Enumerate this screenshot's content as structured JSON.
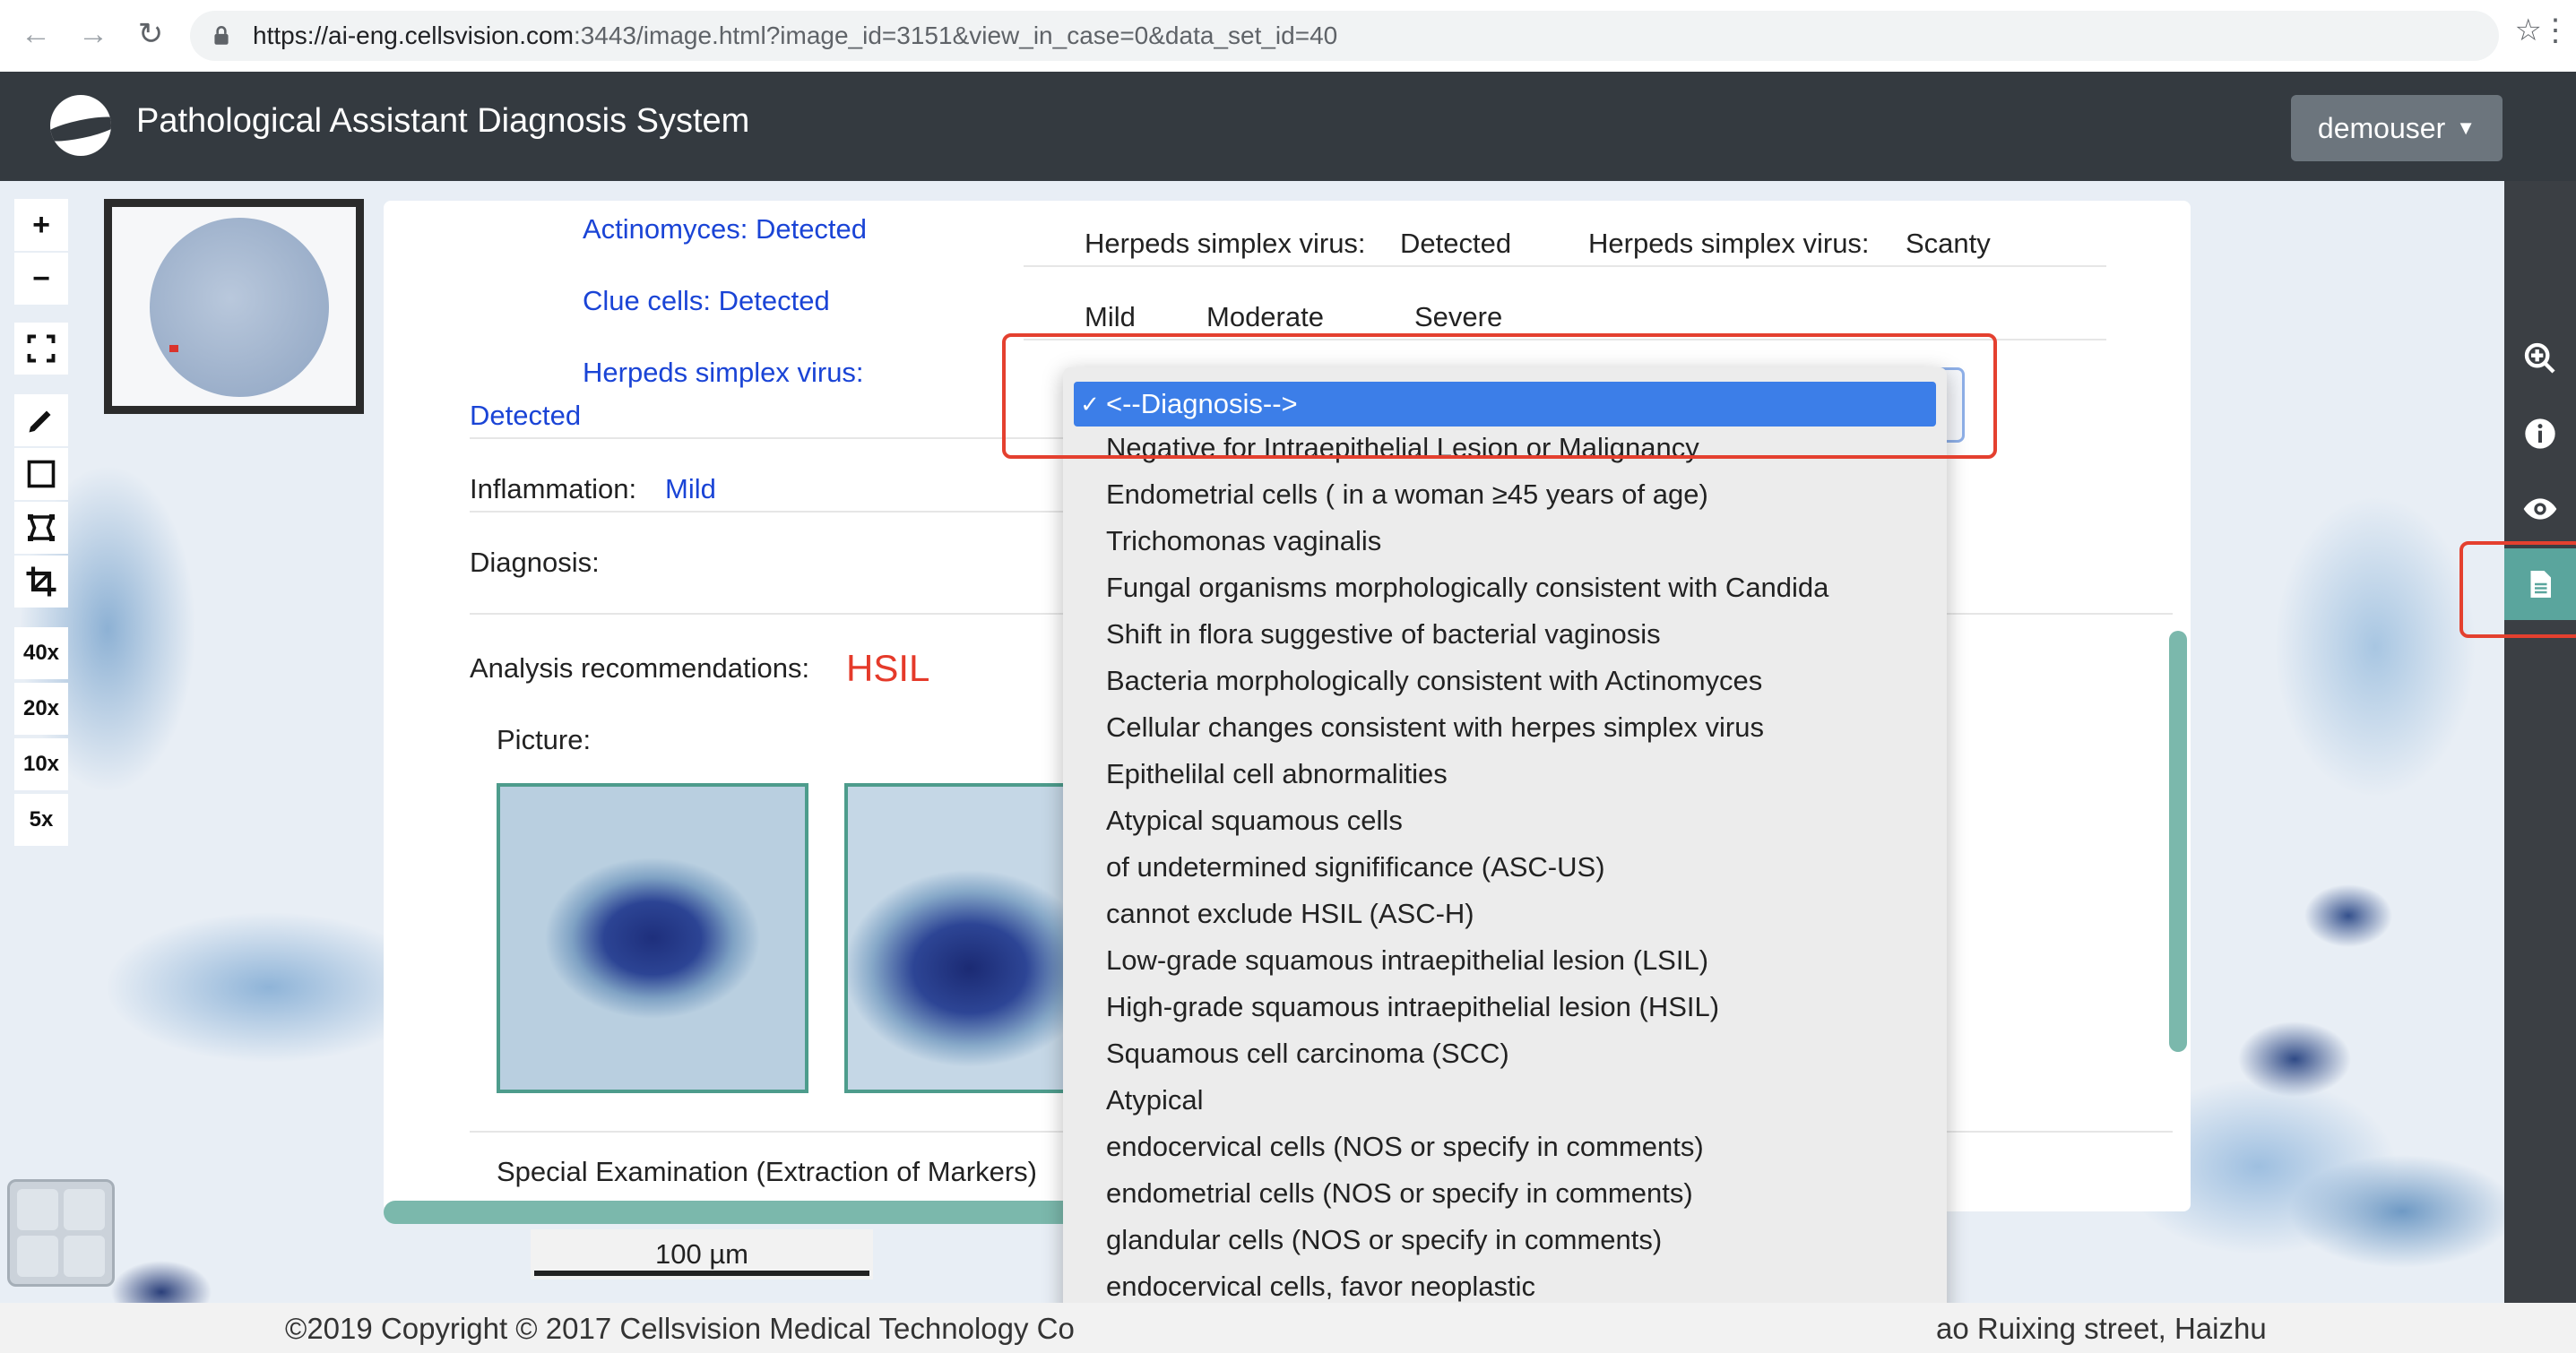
{
  "browser": {
    "url_host": "https://ai-eng.cellsvision.com",
    "url_rest": ":3443/image.html?image_id=3151&view_in_case=0&data_set_id=40"
  },
  "header": {
    "title": "Pathological Assistant Diagnosis System",
    "user": "demouser"
  },
  "toolbar": {
    "zoom_in": "+",
    "zoom_out": "−",
    "magnifications": [
      "40x",
      "20x",
      "10x",
      "5x"
    ]
  },
  "report": {
    "actinomyces": "Actinomyces: Detected",
    "clue_cells": "Clue cells: Detected",
    "herpes_line1": "Herpeds simplex virus:",
    "herpes_line2": "Detected",
    "inflammation_label": "Inflammation:",
    "inflammation_value": "Mild",
    "diagnosis_label": "Diagnosis:",
    "herpes_detected_label": "Herpeds simplex virus:",
    "herpes_detected_value": "Detected",
    "herpes_scanty_label": "Herpeds simplex virus:",
    "herpes_scanty_value": "Scanty",
    "severity": [
      "Mild",
      "Moderate",
      "Severe"
    ],
    "analysis_label": "Analysis recommendations:",
    "analysis_value": "HSIL",
    "picture_label": "Picture:",
    "special_exam": "Special Examination (Extraction of Markers)"
  },
  "scale_bar": "100 µm",
  "dropdown": {
    "selected": "<--Diagnosis-->",
    "options": [
      "Negative for Intraepithelial Lesion or Malignancy",
      "Endometrial cells ( in a woman ≥45 years of age)",
      "Trichomonas vaginalis",
      "Fungal organisms morphologically consistent with Candida",
      "Shift in flora suggestive of bacterial vaginosis",
      "Bacteria morphologically consistent with Actinomyces",
      "Cellular changes consistent with herpes simplex virus",
      "Epithelilal cell abnormalities",
      "Atypical squamous cells",
      "of undetermined signifificance (ASC-US)",
      "cannot exclude HSIL (ASC-H)",
      "Low-grade squamous intraepithelial lesion (LSIL)",
      "High-grade squamous intraepithelial lesion (HSIL)",
      "Squamous cell carcinoma (SCC)",
      "Atypical",
      "endocervical cells (NOS or specify in comments)",
      "endometrial cells (NOS or specify in comments)",
      "glandular cells (NOS or specify in comments)",
      "endocervical cells, favor neoplastic"
    ]
  },
  "footer": {
    "left": "©2019 Copyright © 2017 Cellsvision Medical Technology Co",
    "right": "ao Ruixing street, Haizhu"
  },
  "colors": {
    "header_bg": "#343a40",
    "accent_teal": "#5aa59d",
    "link_blue": "#1a44d6",
    "alert_red": "#e53a2a",
    "select_blue": "#3c7ee8"
  },
  "icons": [
    "back-icon",
    "forward-icon",
    "reload-icon",
    "lock-icon",
    "star-icon",
    "menu-icon",
    "zoom-in-icon",
    "info-icon",
    "eye-icon",
    "document-icon",
    "pencil-icon",
    "rectangle-icon",
    "polygon-icon",
    "crop-icon",
    "fullscreen-icon",
    "chevron-down-icon"
  ]
}
